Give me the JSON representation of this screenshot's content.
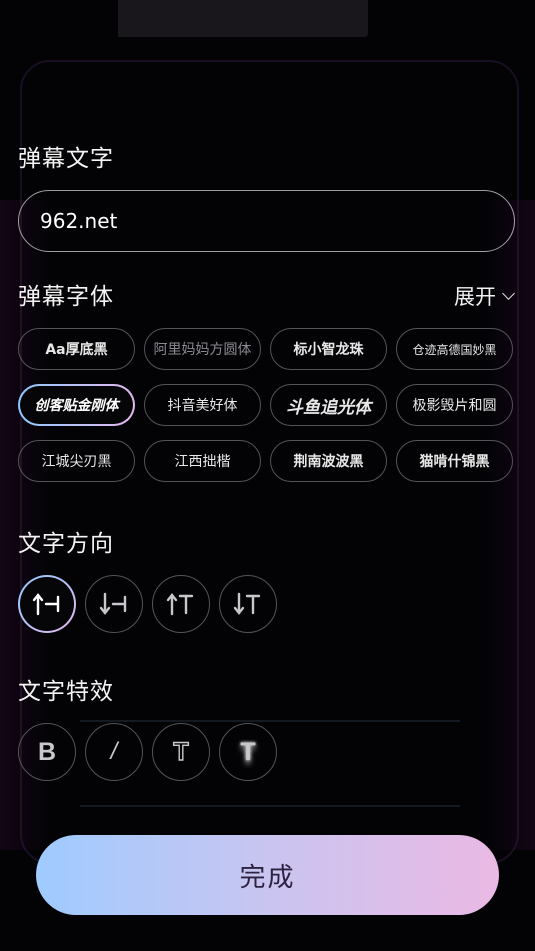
{
  "section_text": {
    "label": "弹幕文字",
    "value": "962.net"
  },
  "section_font": {
    "label": "弹幕字体",
    "expand_label": "展开",
    "fonts": [
      "Aa厚底黑",
      "阿里妈妈方圆体",
      "标小智龙珠",
      "仓迹高德国妙黑",
      "创客贴金刚体",
      "抖音美好体",
      "斗鱼追光体",
      "极影毁片和圆",
      "江城尖刃黑",
      "江西拙楷",
      "荆南波波黑",
      "猫啃什锦黑"
    ],
    "selected_font": "创客贴金刚体"
  },
  "section_direction": {
    "label": "文字方向"
  },
  "section_effect": {
    "label": "文字特效",
    "options": [
      {
        "glyph": "B",
        "icon": "bold-icon"
      },
      {
        "glyph": "/",
        "icon": "italic-icon"
      },
      {
        "glyph": "T",
        "icon": "outline-text-icon"
      },
      {
        "glyph": "T",
        "icon": "shadow-text-icon"
      }
    ]
  },
  "done_button": {
    "label": "完成"
  },
  "colors": {
    "background": "#030306",
    "button_gradient_start": "#9fcbff",
    "button_gradient_end": "#eab9e4",
    "button_text": "#2d2240"
  }
}
